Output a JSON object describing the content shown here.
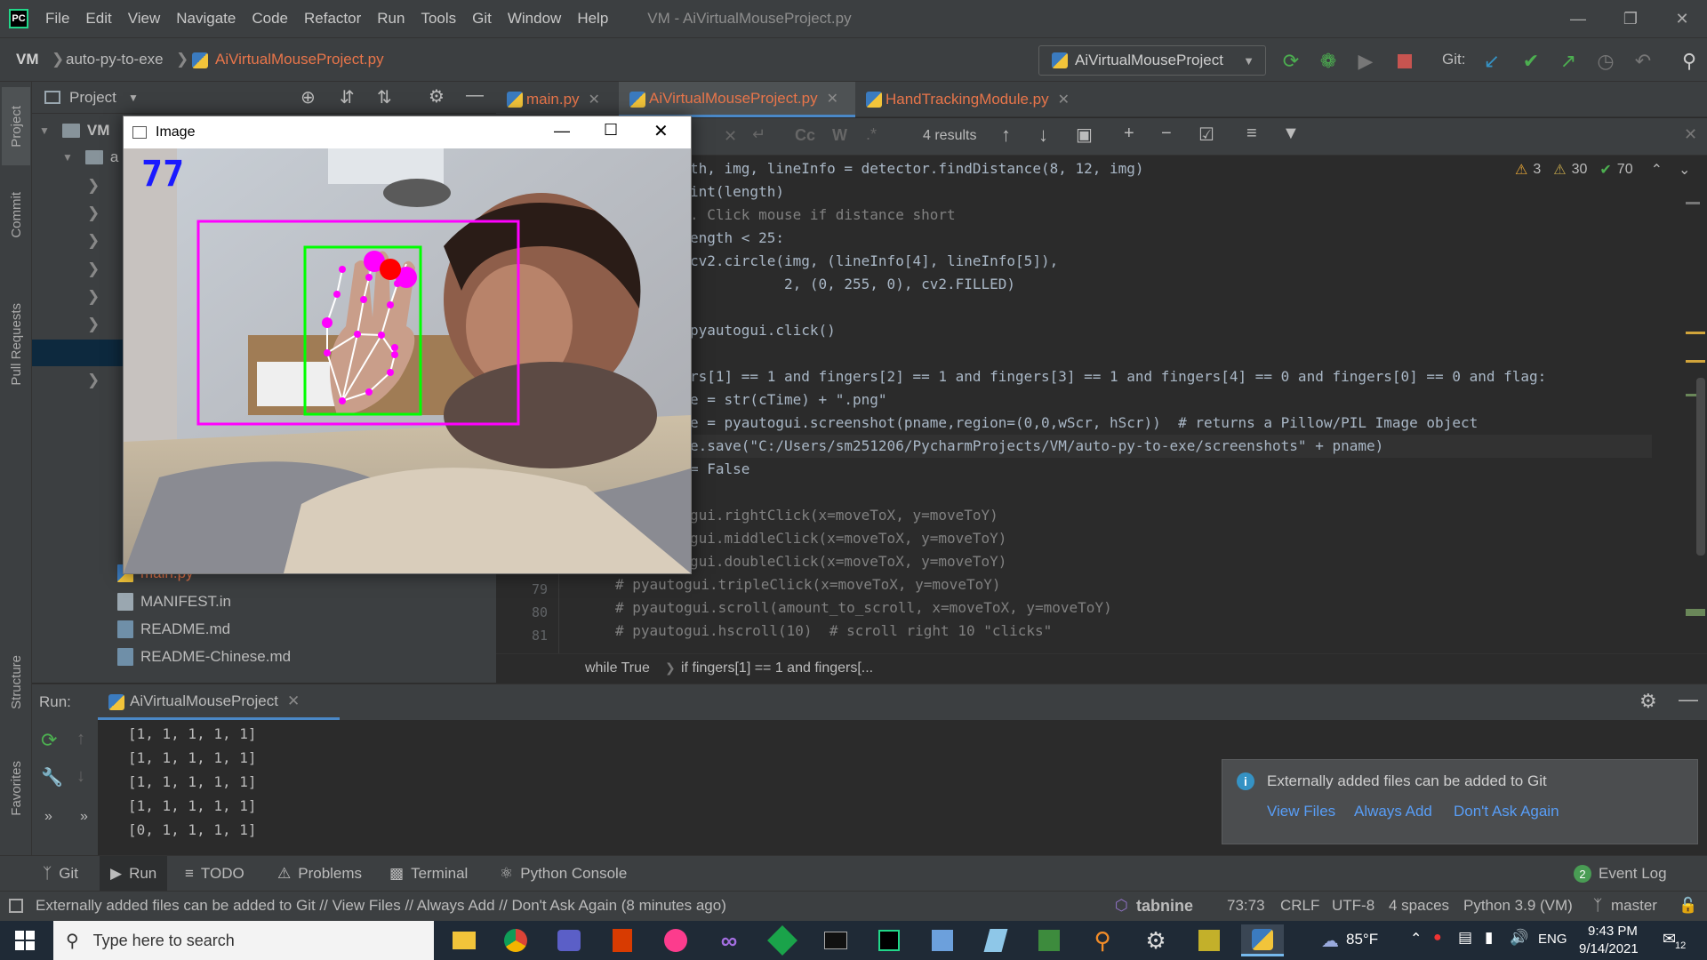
{
  "menu": {
    "items": [
      "File",
      "Edit",
      "View",
      "Navigate",
      "Code",
      "Refactor",
      "Run",
      "Tools",
      "Git",
      "Window",
      "Help"
    ],
    "title": "VM - AiVirtualMouseProject.py"
  },
  "nav": {
    "project": "VM",
    "folder": "auto-py-to-exe",
    "file": "AiVirtualMouseProject.py",
    "run_config": "AiVirtualMouseProject",
    "git_label": "Git:"
  },
  "project_panel": {
    "title": "Project",
    "root": "VM",
    "child": "a",
    "files": [
      "main.py",
      "MANIFEST.in",
      "README.md",
      "README-Chinese.md"
    ]
  },
  "tool_windows": [
    "Project",
    "Commit",
    "Pull Requests",
    "Structure",
    "Favorites"
  ],
  "tabs": [
    {
      "label": "main.py",
      "active": false
    },
    {
      "label": "AiVirtualMouseProject.py",
      "active": true
    },
    {
      "label": "HandTrackingModule.py",
      "active": false
    }
  ],
  "search": {
    "results": "4 results"
  },
  "inspections": {
    "warnings": "3",
    "weak_warnings": "30",
    "typos": "70"
  },
  "code": {
    "l1": "th, img, lineInfo = detector.findDistance(8, 12, img)",
    "l2": "int(length)",
    "l3": ". Click mouse if distance short",
    "l4": "ength < 25:",
    "l5": "cv2.circle(img, (lineInfo[4], lineInfo[5]),",
    "l6": "           2, (0, 255, 0), cv2.FILLED)",
    "l7": "pyautogui.click()",
    "l8": "rs[1] == 1 and fingers[2] == 1 and fingers[3] == 1 and fingers[4] == 0 and fingers[0] == 0 and flag:",
    "l9": "e = str(cTime) + \".png\"",
    "l10": "e = pyautogui.screenshot(pname,region=(0,0,wScr, hScr))  # returns a Pillow/PIL Image object",
    "l11": "e.save(\"C:/Users/sm251206/PycharmProjects/VM/auto-py-to-exe/screenshots\" + pname)",
    "l12": "= False",
    "l13": "gui.rightClick(x=moveToX, y=moveToY)",
    "l14": "gui.middleClick(x=moveToX, y=moveToY)",
    "l15": "gui.doubleClick(x=moveToX, y=moveToY)",
    "l16": "# pyautogui.tripleClick(x=moveToX, y=moveToY)",
    "l17": "# pyautogui.scroll(amount_to_scroll, x=moveToX, y=moveToY)",
    "l18": "# pyautogui.hscroll(10)  # scroll right 10 \"clicks\"",
    "gutter": [
      "79",
      "80",
      "81"
    ]
  },
  "editor_breadcrumb": {
    "a": "while True",
    "b": "if fingers[1] == 1 and fingers[..."
  },
  "run": {
    "label": "Run:",
    "tab": "AiVirtualMouseProject",
    "output": [
      "[1, 1, 1, 1, 1]",
      "[1, 1, 1, 1, 1]",
      "[1, 1, 1, 1, 1]",
      "[1, 1, 1, 1, 1]",
      "[0, 1, 1, 1, 1]"
    ]
  },
  "notification": {
    "message": "Externally added files can be added to Git",
    "actions": [
      "View Files",
      "Always Add",
      "Don't Ask Again"
    ]
  },
  "bottom_tabs": [
    "Git",
    "Run",
    "TODO",
    "Problems",
    "Terminal",
    "Python Console"
  ],
  "event_log": {
    "count": "2",
    "label": "Event Log"
  },
  "status": {
    "message": "Externally added files can be added to Git // View Files // Always Add // Don't Ask Again (8 minutes ago)",
    "tabnine": "tabnine",
    "position": "73:73",
    "line_sep": "CRLF",
    "encoding": "UTF-8",
    "indent": "4 spaces",
    "interpreter": "Python 3.9 (VM)",
    "branch": "master"
  },
  "image_window": {
    "title": "Image",
    "fps": "77"
  },
  "taskbar": {
    "search_placeholder": "Type here to search",
    "weather": "85°F",
    "lang": "ENG",
    "time": "9:43 PM",
    "date": "9/14/2021",
    "notif_count": "12"
  },
  "colors": {
    "ide_bg": "#2b2b2b",
    "panel_bg": "#3c3f41",
    "accent_orange": "#cc7832",
    "link": "#589df6",
    "frame_magenta": "#ff00ff",
    "frame_green": "#00ff00"
  }
}
